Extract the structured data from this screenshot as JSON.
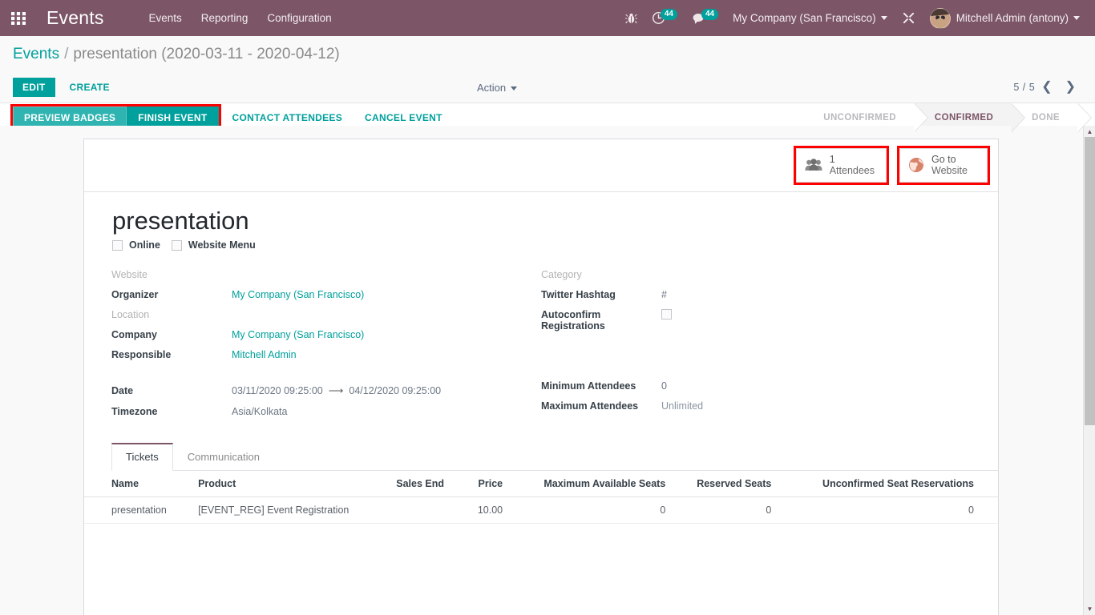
{
  "navbar": {
    "apps_icon": "apps-grid-icon",
    "brand": "Events",
    "menu": [
      {
        "label": "Events"
      },
      {
        "label": "Reporting"
      },
      {
        "label": "Configuration"
      }
    ],
    "systray": {
      "debug_icon": "bug-icon",
      "activity_icon": "clock-activity-icon",
      "activity_count": "44",
      "messaging_icon": "chat-bubble-icon",
      "messaging_count": "44",
      "company": "My Company (San Francisco)",
      "tools_icon": "wrench-screwdriver-icon",
      "user": "Mitchell Admin (antony)",
      "avatar": "user-avatar"
    },
    "colors": {
      "navbar_bg": "#7c5566",
      "badge": "#00A09D"
    }
  },
  "breadcrumb": {
    "root": "Events",
    "separator": "/",
    "current": "presentation (2020-03-11 - 2020-04-12)"
  },
  "control_panel": {
    "edit_label": "EDIT",
    "create_label": "CREATE",
    "action_label": "Action",
    "pager_value": "5 / 5",
    "prev_icon": "chevron-left-icon",
    "next_icon": "chevron-right-icon"
  },
  "status_bar": {
    "buttons": [
      {
        "label": "PREVIEW BADGES",
        "style": "primary-hover",
        "highlighted": true
      },
      {
        "label": "FINISH EVENT",
        "style": "primary",
        "highlighted": true
      },
      {
        "label": "CONTACT ATTENDEES",
        "style": "link",
        "highlighted": false
      },
      {
        "label": "CANCEL EVENT",
        "style": "link",
        "highlighted": false
      }
    ],
    "stages": [
      {
        "label": "UNCONFIRMED",
        "active": false
      },
      {
        "label": "CONFIRMED",
        "active": true
      },
      {
        "label": "DONE",
        "active": false
      }
    ],
    "colors": {
      "primary": "#00A09D",
      "active_stage": "#7c5566",
      "highlight": "#ff0000"
    }
  },
  "smart_buttons": [
    {
      "icon": "attendees-group-icon",
      "value": "1",
      "label": "Attendees",
      "highlighted": true
    },
    {
      "icon": "globe-website-icon",
      "value": "Go to",
      "label": "Website",
      "highlighted": true
    }
  ],
  "form": {
    "title": "presentation",
    "checkboxes": [
      {
        "label": "Online",
        "checked": false
      },
      {
        "label": "Website Menu",
        "checked": false
      }
    ],
    "left_fields": [
      {
        "label": "Website",
        "value": "",
        "muted_label": true,
        "link": false
      },
      {
        "label": "Organizer",
        "value": "My Company (San Francisco)",
        "muted_label": false,
        "link": true
      },
      {
        "label": "Location",
        "value": "",
        "muted_label": true,
        "link": false
      },
      {
        "label": "Company",
        "value": "My Company (San Francisco)",
        "muted_label": false,
        "link": true
      },
      {
        "label": "Responsible",
        "value": "Mitchell Admin",
        "muted_label": false,
        "link": true
      }
    ],
    "right_fields": [
      {
        "label": "Category",
        "value": "",
        "muted_label": true,
        "link": false
      },
      {
        "label": "Twitter Hashtag",
        "value": "#",
        "muted_label": false,
        "link": false
      },
      {
        "label": "Autoconfirm Registrations",
        "value": "",
        "muted_label": false,
        "link": false,
        "checkbox": true
      }
    ],
    "date_row": {
      "label": "Date",
      "start": "03/11/2020 09:25:00",
      "arrow": "arrow-right-icon",
      "end": "04/12/2020 09:25:00"
    },
    "timezone_row": {
      "label": "Timezone",
      "value": "Asia/Kolkata"
    },
    "min_attendees": {
      "label": "Minimum Attendees",
      "value": "0"
    },
    "max_attendees": {
      "label": "Maximum Attendees",
      "value": "Unlimited"
    }
  },
  "notebook": {
    "tabs": [
      {
        "label": "Tickets",
        "active": true
      },
      {
        "label": "Communication",
        "active": false
      }
    ],
    "tickets_table": {
      "columns": [
        {
          "label": "Name",
          "align": "left"
        },
        {
          "label": "Product",
          "align": "left"
        },
        {
          "label": "Sales End",
          "align": "left"
        },
        {
          "label": "Price",
          "align": "right"
        },
        {
          "label": "Maximum Available Seats",
          "align": "right"
        },
        {
          "label": "Reserved Seats",
          "align": "right"
        },
        {
          "label": "Unconfirmed Seat Reservations",
          "align": "right"
        }
      ],
      "rows": [
        {
          "name": "presentation",
          "product": "[EVENT_REG] Event Registration",
          "sales_end": "",
          "price": "10.00",
          "max_seats": "0",
          "reserved_seats": "0",
          "unconfirmed": "0"
        }
      ]
    }
  }
}
